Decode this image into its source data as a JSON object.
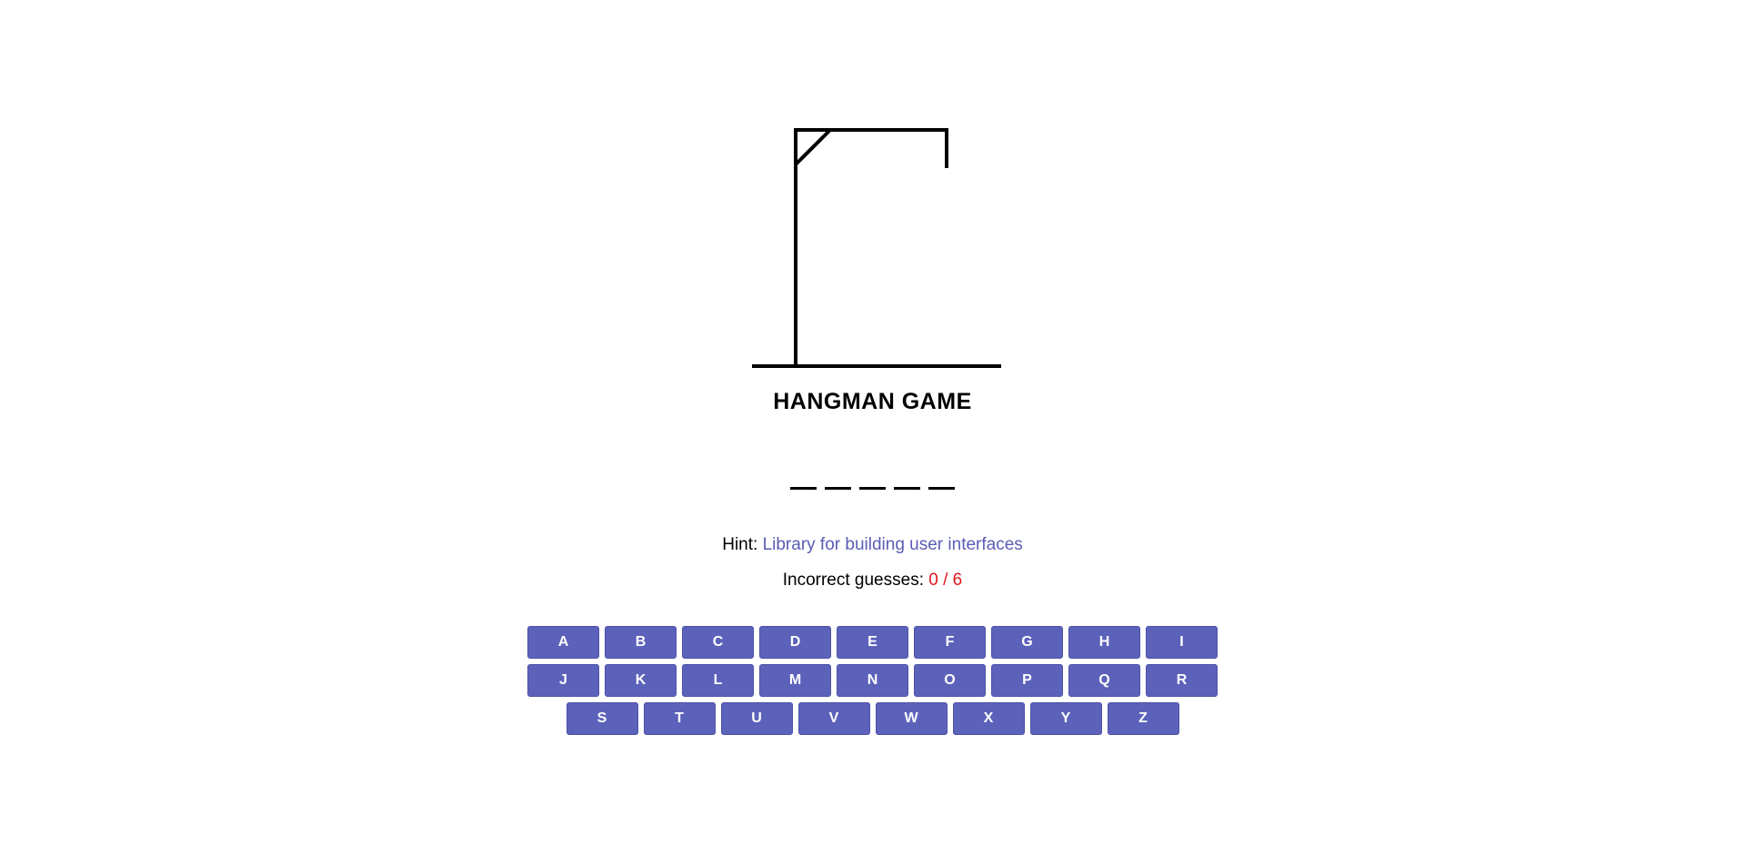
{
  "title": "HANGMAN GAME",
  "word": {
    "length": 5,
    "revealed": [
      "",
      "",
      "",
      "",
      ""
    ]
  },
  "hint": {
    "label": "Hint:",
    "text": "Library for building user interfaces"
  },
  "guesses": {
    "label": "Incorrect guesses:",
    "count": "0 / 6"
  },
  "colors": {
    "key_background": "#5c62ba",
    "key_text": "#ffffff",
    "hint_text": "#5a5db4",
    "guess_count": "#e0141e"
  },
  "keyboard": {
    "rows": [
      [
        "A",
        "B",
        "C",
        "D",
        "E",
        "F",
        "G",
        "H",
        "I"
      ],
      [
        "J",
        "K",
        "L",
        "M",
        "N",
        "O",
        "P",
        "Q",
        "R"
      ],
      [
        "S",
        "T",
        "U",
        "V",
        "W",
        "X",
        "Y",
        "Z"
      ]
    ]
  }
}
